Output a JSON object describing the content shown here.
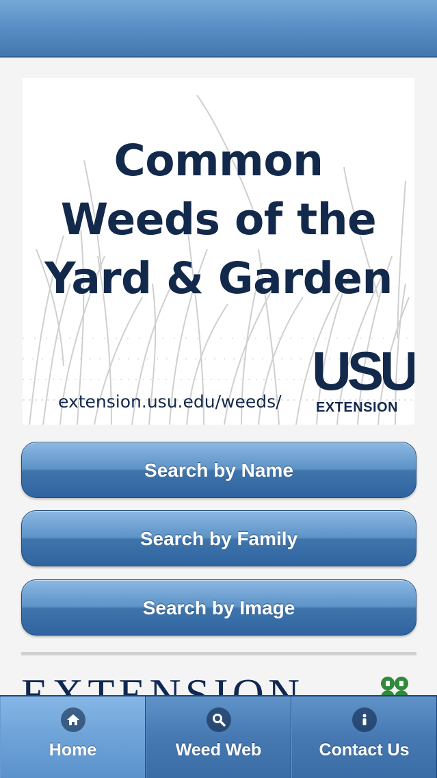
{
  "banner": {
    "title_lines": [
      "Common",
      "Weeds of the",
      "Yard & Garden"
    ],
    "url": "extension.usu.edu/weeds/",
    "logo_mark": "USU",
    "logo_sub": "EXTENSION"
  },
  "buttons": {
    "search_by_name": "Search by Name",
    "search_by_family": "Search by Family",
    "search_by_image": "Search by Image"
  },
  "footer_logo": {
    "word": "EXTENSION"
  },
  "tabs": [
    {
      "label": "Home",
      "icon": "home-icon",
      "active": true
    },
    {
      "label": "Weed Web",
      "icon": "search-icon",
      "active": false
    },
    {
      "label": "Contact Us",
      "icon": "info-icon",
      "active": false
    }
  ],
  "colors": {
    "accent": "#4679b2",
    "banner_text": "#13294b"
  }
}
